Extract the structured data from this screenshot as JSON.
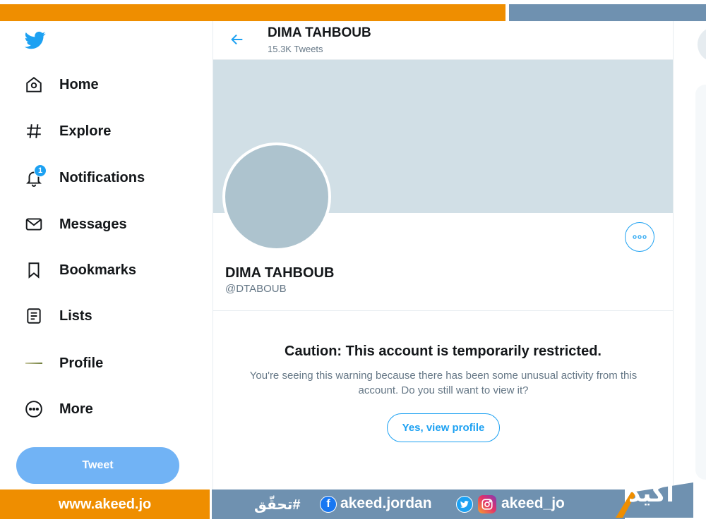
{
  "sidebar": {
    "items": [
      {
        "label": "Home",
        "icon": "home-icon"
      },
      {
        "label": "Explore",
        "icon": "hashtag-icon"
      },
      {
        "label": "Notifications",
        "icon": "bell-icon",
        "badge": "1"
      },
      {
        "label": "Messages",
        "icon": "envelope-icon"
      },
      {
        "label": "Bookmarks",
        "icon": "bookmark-icon"
      },
      {
        "label": "Lists",
        "icon": "list-icon"
      },
      {
        "label": "Profile",
        "icon": "profile-icon"
      },
      {
        "label": "More",
        "icon": "more-circle-icon"
      }
    ],
    "tweet_button": "Tweet"
  },
  "header": {
    "name": "DIMA TAHBOUB",
    "tweet_count": "15.3K Tweets"
  },
  "profile": {
    "name": "DIMA TAHBOUB",
    "handle": "@DTABOUB"
  },
  "warning": {
    "title": "Caution: This account is temporarily restricted.",
    "text": "You're seeing this warning because there has been some unusual activity from this account. Do you still want to view it?",
    "button": "Yes, view profile"
  },
  "footer": {
    "website": "www.akeed.jo",
    "hashtag": "#تحقّق",
    "facebook": "akeed.jordan",
    "social": "akeed_jo",
    "logo_text": "أكيد"
  },
  "colors": {
    "accent": "#1da1f2",
    "orange": "#ef8e00",
    "steel_blue": "#6f91b0",
    "banner": "#d1dfe6",
    "avatar": "#adc3ce"
  }
}
